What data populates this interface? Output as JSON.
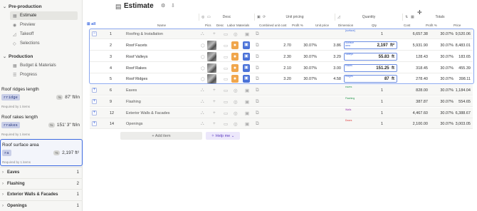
{
  "sidebar": {
    "sections": [
      {
        "label": "Pre-production",
        "items": [
          {
            "label": "Estimate",
            "icon": "table-icon",
            "active": true
          },
          {
            "label": "Preview",
            "icon": "eye-icon"
          },
          {
            "label": "Takeoff",
            "icon": "ruler-icon"
          },
          {
            "label": "Selections",
            "icon": "tag-icon"
          }
        ]
      },
      {
        "label": "Production",
        "items": [
          {
            "label": "Budget & Materials",
            "icon": "table-icon"
          },
          {
            "label": "Progress",
            "icon": "list-icon"
          }
        ]
      }
    ],
    "variables": [
      {
        "title": "Roof ridges length",
        "chip": "rridge",
        "value": "87' ft/in",
        "req": "Required by 1 items"
      },
      {
        "title": "Roof rakes length",
        "chip": "rrakes",
        "value": "151' 3\" ft/in",
        "req": "Required by 1 items"
      },
      {
        "title": "Roof surface area",
        "chip": "ra",
        "value": "2,197 ft²",
        "req": "Required by 1 items"
      }
    ],
    "groups": [
      {
        "label": "Eaves",
        "count": "1"
      },
      {
        "label": "Flashing",
        "count": "2"
      },
      {
        "label": "Exterior Walls & Facades",
        "count": "1"
      },
      {
        "label": "Openings",
        "count": "1"
      }
    ]
  },
  "header": {
    "title": "Estimate"
  },
  "column_groups": {
    "desc": "Desc",
    "unit_pricing": "Unit pricing",
    "quantity": "Quantity",
    "totals": "Totals"
  },
  "columns": {
    "name": "Name",
    "pics": "Pics",
    "desc": "Desc",
    "labor": "Labor",
    "materials": "Materials",
    "combined": "Combined unit cost",
    "profit": "Profit %",
    "unit_price": "Unit price",
    "dimension": "Dimension",
    "qty": "Qty",
    "cost": "Cost",
    "profit2": "Profit %",
    "price": "Price"
  },
  "all_label": "all",
  "rows": [
    {
      "num": "1",
      "name": "Roofing & Installation",
      "kind": "group",
      "dim": "{surface}",
      "qty": "1",
      "cost": "6,657.38",
      "profit": "30.07%",
      "price": "9,520.06"
    },
    {
      "num": "2",
      "name": "Roof Facets",
      "kind": "sub",
      "combined": "2.70",
      "uprofit": "30.07%",
      "uprice": "3.86",
      "dim": "Surface area",
      "qty": "2,197",
      "unit": "ft²",
      "cost": "5,931.90",
      "profit": "30.07%",
      "price": "8,483.01"
    },
    {
      "num": "3",
      "name": "Roof Valleys",
      "kind": "sub",
      "combined": "2.30",
      "uprofit": "30.07%",
      "uprice": "3.29",
      "dim": "Valleys",
      "qty": "55.83",
      "unit": "ft",
      "cost": "128.43",
      "profit": "30.07%",
      "price": "183.65"
    },
    {
      "num": "4",
      "name": "Roof Rakes",
      "kind": "sub",
      "combined": "2.10",
      "uprofit": "30.07%",
      "uprice": "3.00",
      "dim": "Rakes",
      "qty": "151.25",
      "unit": "ft",
      "cost": "318.45",
      "profit": "30.07%",
      "price": "455.39"
    },
    {
      "num": "5",
      "name": "Roof Ridges",
      "kind": "sub",
      "combined": "3.20",
      "uprofit": "30.07%",
      "uprice": "4.58",
      "dim": "Ridges",
      "qty": "87",
      "unit": "ft",
      "cost": "278.40",
      "profit": "30.07%",
      "price": "398.11"
    },
    {
      "num": "6",
      "name": "Eaves",
      "kind": "group",
      "dim": "eaves",
      "qty": "1",
      "cost": "828.00",
      "profit": "30.07%",
      "price": "1,184.04"
    },
    {
      "num": "9",
      "name": "Flashing",
      "kind": "group",
      "dim": "Flashing",
      "qty": "1",
      "cost": "387.87",
      "profit": "30.07%",
      "price": "554.65"
    },
    {
      "num": "12",
      "name": "Exterior Walls & Facades",
      "kind": "group",
      "dim": "Walls",
      "qty": "1",
      "cost": "4,467.60",
      "profit": "30.07%",
      "price": "6,388.67"
    },
    {
      "num": "14",
      "name": "Openings",
      "kind": "group",
      "dim": "Doors",
      "qty": "1",
      "cost": "2,100.00",
      "profit": "30.07%",
      "price": "3,003.05"
    }
  ],
  "actions": {
    "add_item": "+ Add item",
    "help_me": "Help me"
  }
}
